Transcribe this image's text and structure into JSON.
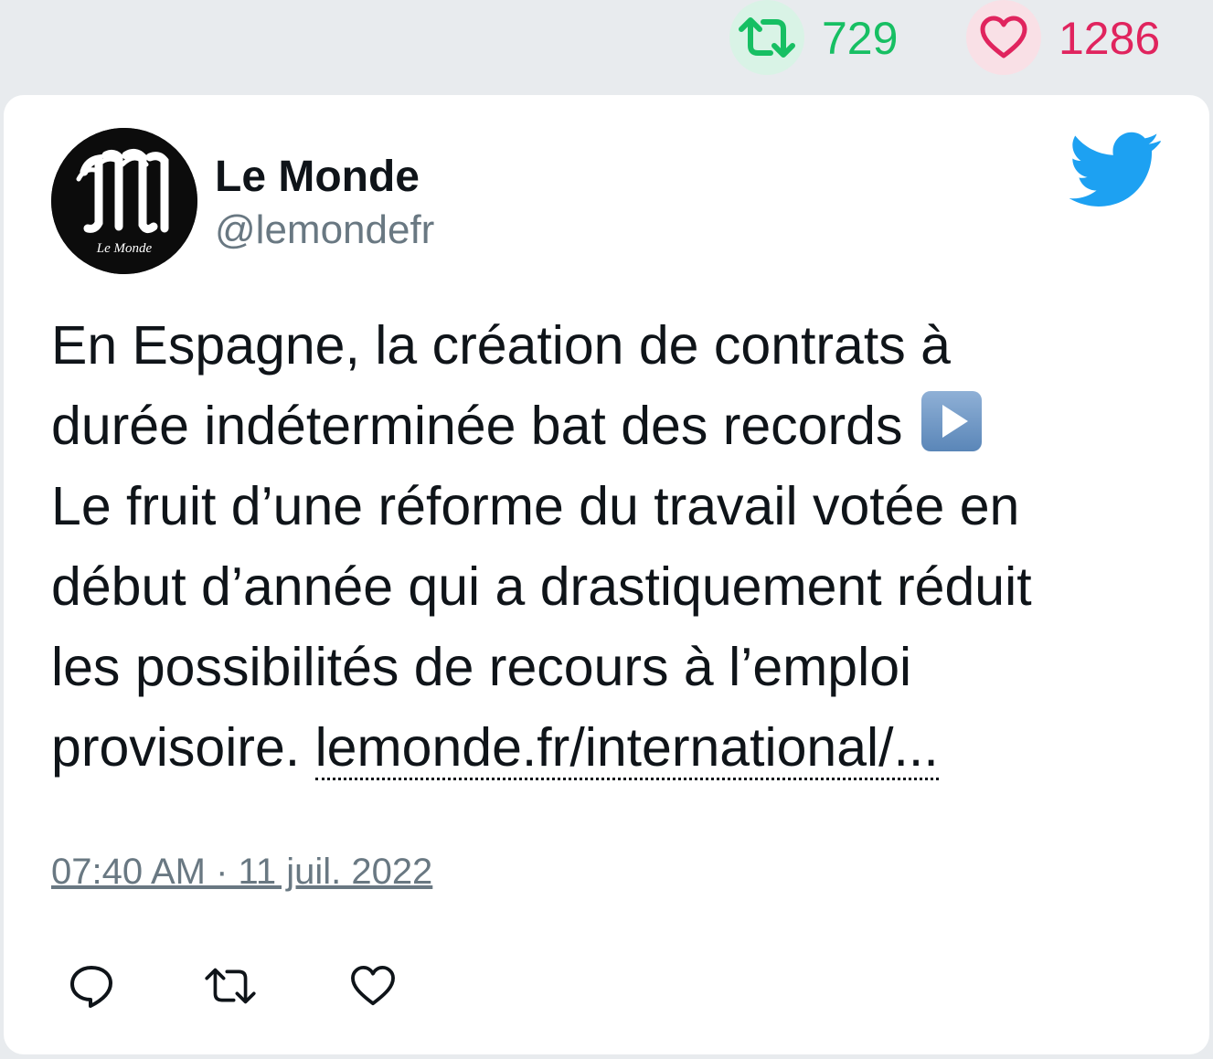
{
  "stats": {
    "retweet_icon": "retweet-icon",
    "retweet_count": "729",
    "like_icon": "heart-icon",
    "like_count": "1286",
    "retweet_color": "#17bf63",
    "like_color": "#e0245e"
  },
  "tweet": {
    "author": {
      "display_name": "Le Monde",
      "handle": "@lemondefr",
      "avatar_logo_text": "Le Monde"
    },
    "brand_icon": "twitter-bird-icon",
    "brand_color": "#1da1f2",
    "text_lines": [
      "En Espagne, la création de contrats à",
      "durée indéterminée bat des records",
      "Le fruit d’une réforme du travail votée en",
      "début d’année qui a drastiquement réduit",
      "les possibilités de recours à l’emploi",
      "provisoire."
    ],
    "emoji": "play-button-emoji",
    "link_text": "lemonde.fr/international/...",
    "timestamp": "07:40 AM · 11 juil. 2022"
  },
  "actions": [
    {
      "icon": "reply-icon"
    },
    {
      "icon": "retweet-icon"
    },
    {
      "icon": "heart-icon"
    }
  ]
}
